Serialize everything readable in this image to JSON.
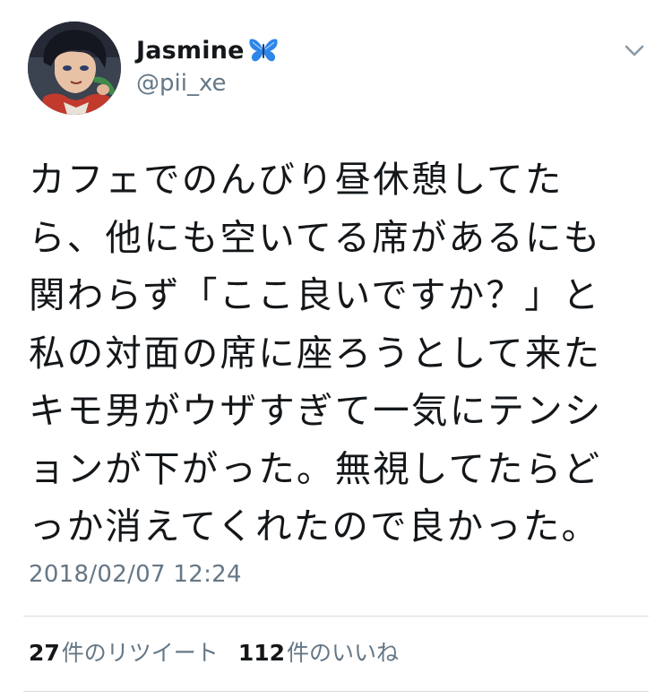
{
  "tweet": {
    "user": {
      "display_name": "Jasmine",
      "name_emoji": "butterfly-icon",
      "handle": "@pii_xe",
      "avatar": "avatar-anime-character"
    },
    "menu_icon": "chevron-down-icon",
    "text": "カフェでのんびり昼休憩してた\nら、他にも空いてる席があるにも\n関わらず「ここ良いですか？」と\n私の対面の席に座ろうとして来た\nキモ男がウザすぎて一気にテンシ\nョンが下がった。無視してたらど\nっか消えてくれたので良かった。",
    "timestamp": "2018/02/07 12:24",
    "stats": {
      "retweets": {
        "count": "27",
        "label": "件のリツイート"
      },
      "likes": {
        "count": "112",
        "label": "件のいいね"
      }
    }
  },
  "colors": {
    "text_primary": "#14171a",
    "text_secondary": "#657786",
    "divider": "#d8dde1",
    "butterfly": "#2e86e8"
  }
}
